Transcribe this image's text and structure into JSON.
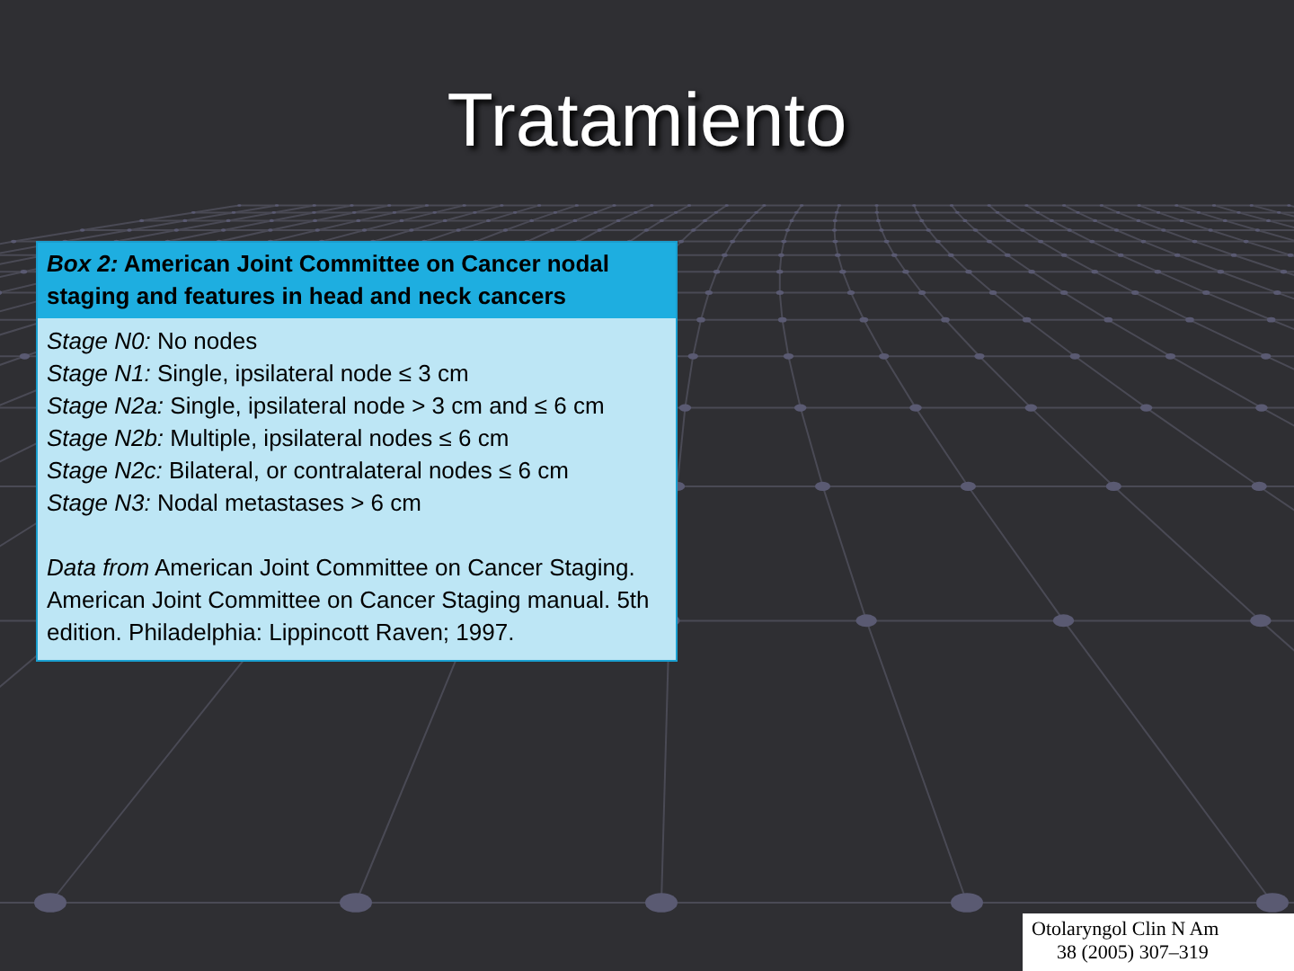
{
  "slide": {
    "title": "Tratamiento",
    "box": {
      "heading": "*Box 2:*  American Joint Committee on Cancer nodal staging and features in head and neck cancers",
      "stages": [
        "*Stage N0:* No nodes",
        "*Stage N1:* Single, ipsilateral node ≤ 3 cm",
        "*Stage N2a:* Single, ipsilateral node > 3 cm and ≤ 6 cm",
        "*Stage N2b:* Multiple, ipsilateral nodes ≤ 6 cm",
        "*Stage N2c:* Bilateral, or contralateral nodes ≤ 6 cm",
        "*Stage N3:* Nodal metastases > 6 cm"
      ],
      "source": "*Data from* American Joint Committee on Cancer Staging. American Joint Committee on Cancer Staging manual. 5th edition. Philadelphia: Lippincott Raven; 1997."
    },
    "citation": [
      "Otolaryngol Clin N Am",
      "38 (2005) 307–319"
    ]
  }
}
